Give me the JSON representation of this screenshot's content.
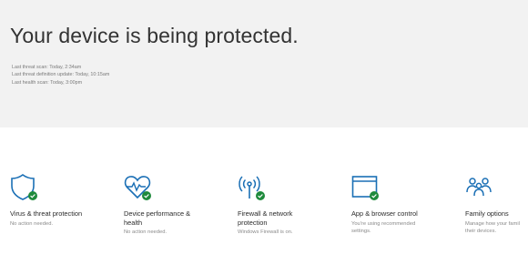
{
  "hero": {
    "title": "Your device is being protected.",
    "scans": [
      "Last threat scan: Today, 2:34am",
      "Last threat definition update: Today, 10:15am",
      "Last health scan: Today, 3:00pm"
    ]
  },
  "tiles": [
    {
      "icon": "shield-icon",
      "title_lines": [
        "Virus & threat protection"
      ],
      "status_lines": [
        "No action needed."
      ]
    },
    {
      "icon": "heart-pulse-icon",
      "title_lines": [
        "Device performance &",
        "health"
      ],
      "status_lines": [
        "No action needed."
      ]
    },
    {
      "icon": "wireless-signal-icon",
      "title_lines": [
        "Firewall & network",
        "protection"
      ],
      "status_lines": [
        "Windows Firewall is on."
      ]
    },
    {
      "icon": "browser-window-icon",
      "title_lines": [
        "App & browser control"
      ],
      "status_lines": [
        "You're using recommended",
        "settings."
      ]
    },
    {
      "icon": "family-icon",
      "title_lines": [
        "Family options"
      ],
      "status_lines": [
        "Manage how your famil",
        "their devices."
      ]
    }
  ],
  "colors": {
    "accent": "#1a6fb5",
    "ok": "#1e8a3c",
    "hero_bg": "#f2f2f2"
  }
}
